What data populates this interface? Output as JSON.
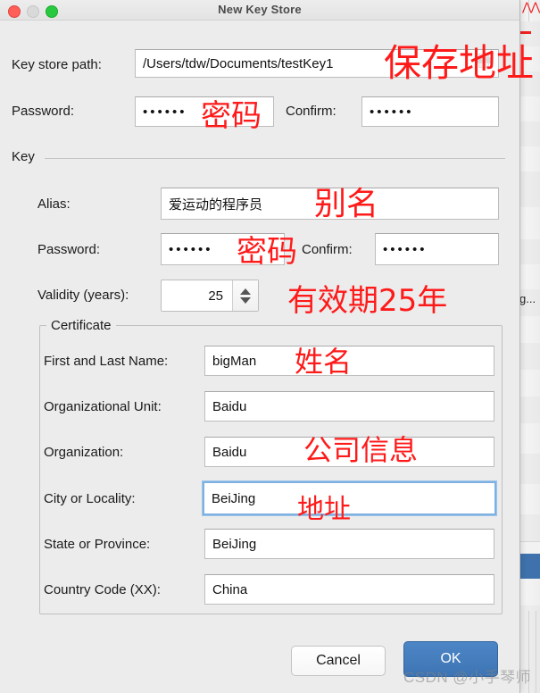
{
  "window": {
    "title": "New Key Store",
    "traffic_lights": [
      {
        "name": "close",
        "color": "#ff5f57"
      },
      {
        "name": "minimize",
        "color": "#d9d9d9"
      },
      {
        "name": "zoom",
        "color": "#28c940"
      }
    ]
  },
  "top_section": {
    "keystore_path": {
      "label": "Key store path:",
      "value": "/Users/tdw/Documents/testKey1",
      "icon": "file-save-icon"
    },
    "password": {
      "label": "Password:",
      "value": "••••••"
    },
    "confirm": {
      "label": "Confirm:",
      "value": "••••••"
    }
  },
  "key_section": {
    "group_label": "Key",
    "alias": {
      "label": "Alias:",
      "value": "爱运动的程序员"
    },
    "password": {
      "label": "Password:",
      "value": "••••••"
    },
    "confirm": {
      "label": "Confirm:",
      "value": "••••••"
    },
    "validity": {
      "label": "Validity (years):",
      "value": "25"
    }
  },
  "certificate_section": {
    "group_label": "Certificate",
    "rows": [
      {
        "label": "First and Last Name:",
        "value": "bigMan",
        "focused": false
      },
      {
        "label": "Organizational Unit:",
        "value": "Baidu",
        "focused": false
      },
      {
        "label": "Organization:",
        "value": "Baidu",
        "focused": false
      },
      {
        "label": "City or Locality:",
        "value": "BeiJing",
        "focused": true
      },
      {
        "label": "State or Province:",
        "value": "BeiJing",
        "focused": false
      },
      {
        "label": "Country Code (XX):",
        "value": "China",
        "focused": false
      }
    ]
  },
  "footer": {
    "cancel_label": "Cancel",
    "ok_label": "OK"
  },
  "annotations": [
    {
      "text": "保存地址",
      "meaning": "save-path"
    },
    {
      "text": "密码",
      "meaning": "keystore-password"
    },
    {
      "text": "别名",
      "meaning": "alias"
    },
    {
      "text": "密码",
      "meaning": "key-password"
    },
    {
      "text": "有效期25年",
      "meaning": "validity-25-years"
    },
    {
      "text": "姓名",
      "meaning": "name"
    },
    {
      "text": "公司信息",
      "meaning": "company-info"
    },
    {
      "text": "地址",
      "meaning": "address"
    }
  ],
  "background_window": {
    "truncated_text": "g..."
  },
  "watermark": {
    "text": "CSDN @小手琴师"
  },
  "colors": {
    "accent_blue": "#417cbf",
    "focus_ring": "#7eb0e0",
    "annotation_red": "#ff1a1a",
    "dialog_bg": "#ececec"
  }
}
